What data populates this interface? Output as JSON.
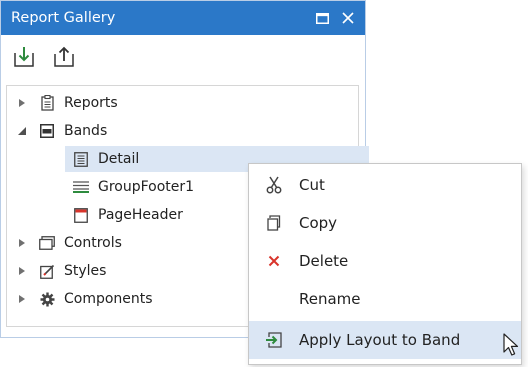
{
  "panel": {
    "title": "Report Gallery",
    "buttons": {
      "restore": "restore-icon",
      "close": "close-icon"
    },
    "toolbar": {
      "import": "import-icon",
      "export": "export-icon"
    },
    "tree": [
      {
        "label": "Reports",
        "icon": "reports-icon",
        "expanded": false
      },
      {
        "label": "Bands",
        "icon": "bands-icon",
        "expanded": true
      },
      {
        "label": "Detail",
        "icon": "detail-band-icon",
        "selected": true
      },
      {
        "label": "GroupFooter1",
        "icon": "group-footer-icon"
      },
      {
        "label": "PageHeader",
        "icon": "page-header-icon"
      },
      {
        "label": "Controls",
        "icon": "controls-icon",
        "expanded": false
      },
      {
        "label": "Styles",
        "icon": "styles-icon",
        "expanded": false
      },
      {
        "label": "Components",
        "icon": "components-icon",
        "expanded": false
      }
    ]
  },
  "context_menu": {
    "items": [
      {
        "label": "Cut",
        "icon": "scissors-icon"
      },
      {
        "label": "Copy",
        "icon": "copy-icon"
      },
      {
        "label": "Delete",
        "icon": "delete-icon"
      },
      {
        "label": "Rename",
        "icon": ""
      },
      {
        "label": "Apply Layout to Band",
        "icon": "apply-layout-icon",
        "highlighted": true
      }
    ]
  },
  "colors": {
    "title_bar": "#2b78c8",
    "selection": "#dbe6f4",
    "icon_green": "#2e8b3e",
    "delete_red": "#d9342b"
  }
}
